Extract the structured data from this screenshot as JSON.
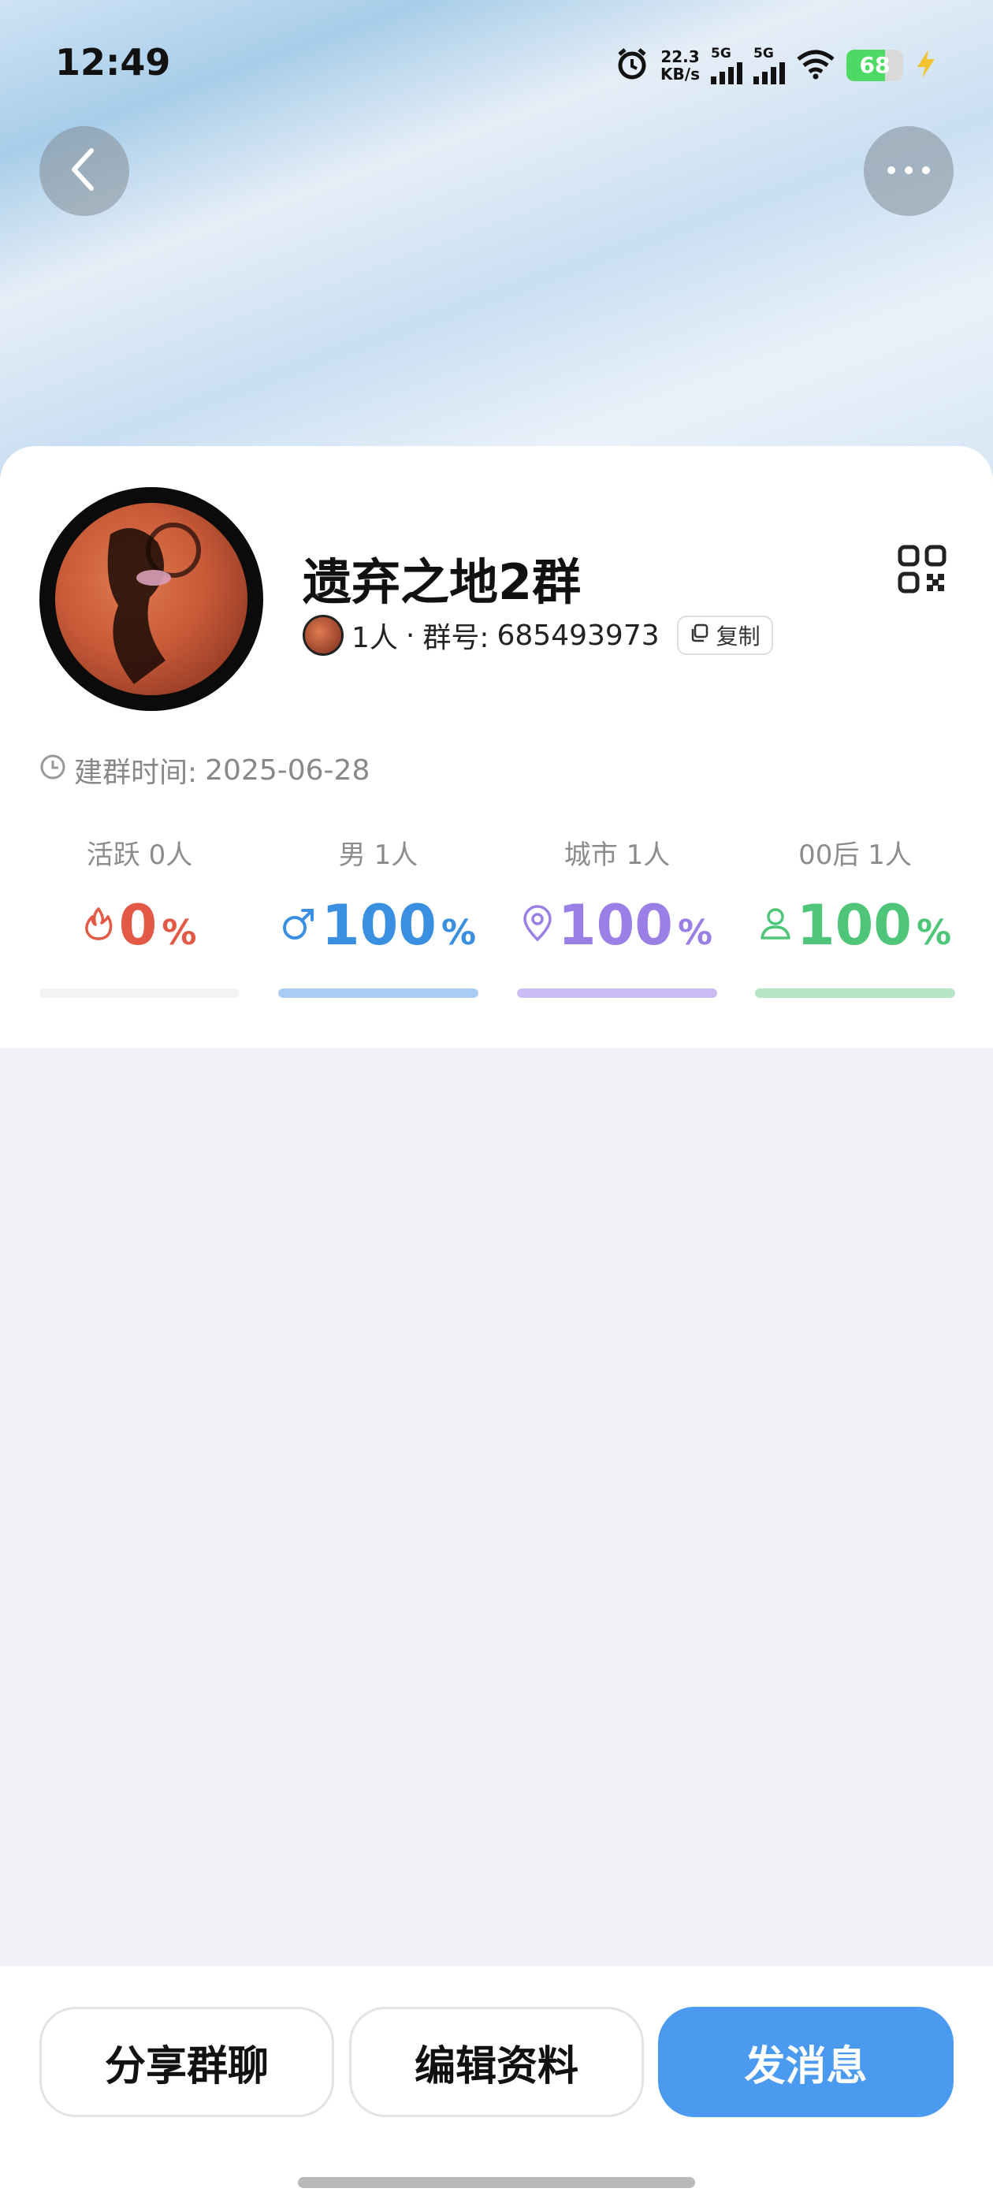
{
  "status_bar": {
    "time": "12:49",
    "net_speed_value": "22.3",
    "net_speed_unit": "KB/s",
    "signal_1": "5G",
    "signal_2": "5G",
    "battery": "68",
    "battery_level": 0.68,
    "icons": [
      "alarm-icon",
      "signal-icon",
      "signal-icon",
      "wifi-icon",
      "battery-icon",
      "charging-icon"
    ]
  },
  "header": {
    "back_icon": "chevron-left-icon",
    "more_icon": "more-dots-icon"
  },
  "group": {
    "name": "遗弃之地2群",
    "members": "1人",
    "separator": "·",
    "id_label": "群号:",
    "id_value": "685493973",
    "copy_label": "复制",
    "qr_icon": "qr-code-icon",
    "created_label": "建群时间:",
    "created_date": "2025-06-28"
  },
  "stats": [
    {
      "label": "活跃 0人",
      "value": "0",
      "unit": "%",
      "percent": 0,
      "icon": "fire-icon",
      "color": "#e25a45",
      "bar_color": "#f3f3f3"
    },
    {
      "label": "男 1人",
      "value": "100",
      "unit": "%",
      "percent": 100,
      "icon": "male-icon",
      "color": "#3a8fe0",
      "bar_color": "#a9cdf4"
    },
    {
      "label": "城市 1人",
      "value": "100",
      "unit": "%",
      "percent": 100,
      "icon": "location-pin-icon",
      "color": "#9a7fe6",
      "bar_color": "#cbbdf4"
    },
    {
      "label": "00后 1人",
      "value": "100",
      "unit": "%",
      "percent": 100,
      "icon": "person-icon",
      "color": "#4fc57a",
      "bar_color": "#b4e6c5"
    }
  ],
  "actions": {
    "share": "分享群聊",
    "edit": "编辑资料",
    "message": "发消息"
  }
}
